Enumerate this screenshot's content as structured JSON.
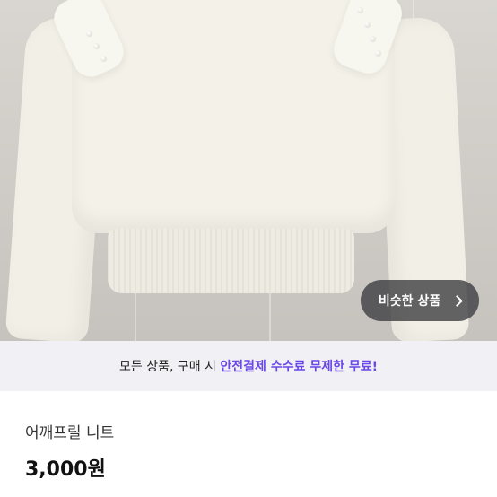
{
  "product_image": {
    "icon": "sweater-photo"
  },
  "similar_button": {
    "label": "비슷한 상품",
    "icon": "chevron-right-icon"
  },
  "promo_banner": {
    "text_prefix": "모든 상품, 구매 시 ",
    "text_accent": "안전결제 수수료 무제한 무료!",
    "accent_color": "#6a47e8"
  },
  "product": {
    "title": "어깨프릴 니트",
    "price": "3,000원"
  }
}
